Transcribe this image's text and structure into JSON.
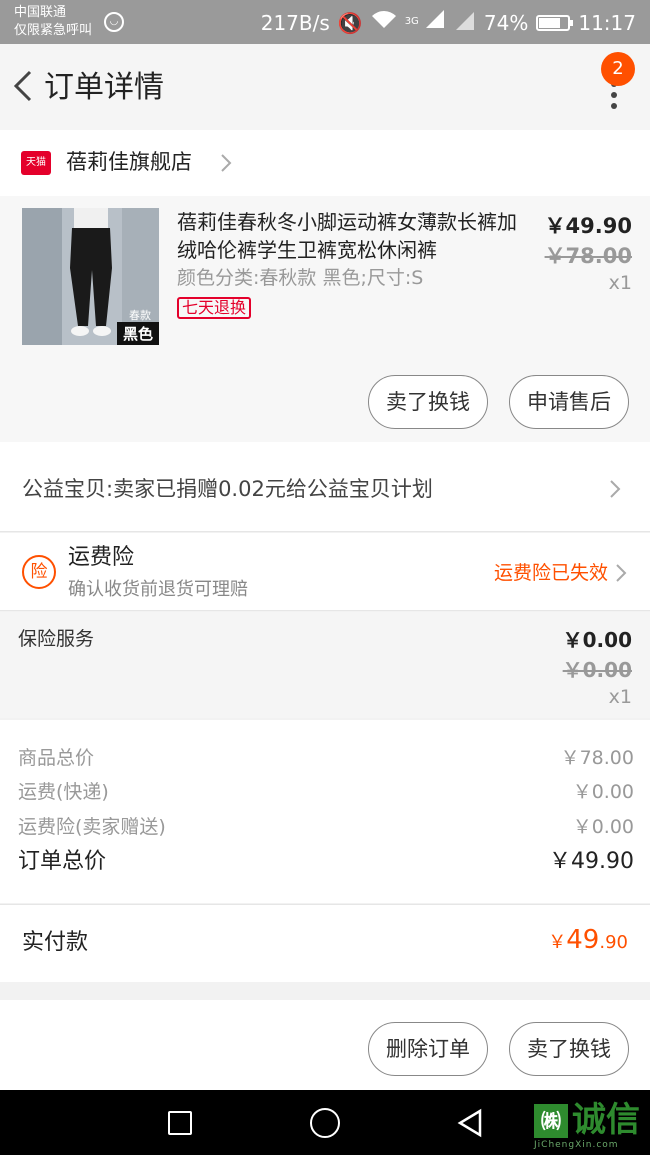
{
  "status_bar": {
    "carrier_line1": "中国联通",
    "carrier_line2": "仅限紧急呼叫",
    "net_speed": "217B/s",
    "signal_label": "3G",
    "battery_text": "74%",
    "battery_level": 0.74,
    "time": "11:17"
  },
  "header": {
    "title": "订单详情",
    "badge_count": "2"
  },
  "shop": {
    "icon_text": "天猫",
    "name": "蓓莉佳旗舰店"
  },
  "item": {
    "image_tag_top": "春款",
    "image_tag": "黑色",
    "title": "蓓莉佳春秋冬小脚运动裤女薄款长裤加绒哈伦裤学生卫裤宽松休闲裤",
    "sku": "颜色分类:春秋款 黑色;尺寸:S",
    "return_tag": "七天退换",
    "price": "￥49.90",
    "original_price": "￥78.00",
    "quantity": "x1",
    "sell_button": "卖了换钱",
    "aftersale_button": "申请售后"
  },
  "charity": {
    "text": "公益宝贝:卖家已捐赠0.02元给公益宝贝计划"
  },
  "shipping_insurance": {
    "icon_text": "险",
    "title": "运费险",
    "subtitle": "确认收货前退货可理赔",
    "status": "运费险已失效"
  },
  "insurance_service": {
    "label": "保险服务",
    "price": "￥0.00",
    "original_price": "￥0.00",
    "quantity": "x1"
  },
  "summary": {
    "rows": [
      {
        "label": "商品总价",
        "value": "￥78.00"
      },
      {
        "label": "运费(快递)",
        "value": "￥0.00"
      },
      {
        "label": "运费险(卖家赠送)",
        "value": "￥0.00"
      }
    ],
    "total_label": "订单总价",
    "total_value": "￥49.90"
  },
  "payment": {
    "label": "实付款",
    "currency": "￥",
    "amount_int": "49",
    "amount_dec": ".90"
  },
  "actions": {
    "delete_button": "删除订单",
    "sell_button": "卖了换钱"
  },
  "watermark": {
    "logo_char": "㈱",
    "text": "诚信",
    "url": "JiChengXin.com"
  },
  "colors": {
    "accent": "#ff5000",
    "tmall_red": "#e4002b"
  }
}
